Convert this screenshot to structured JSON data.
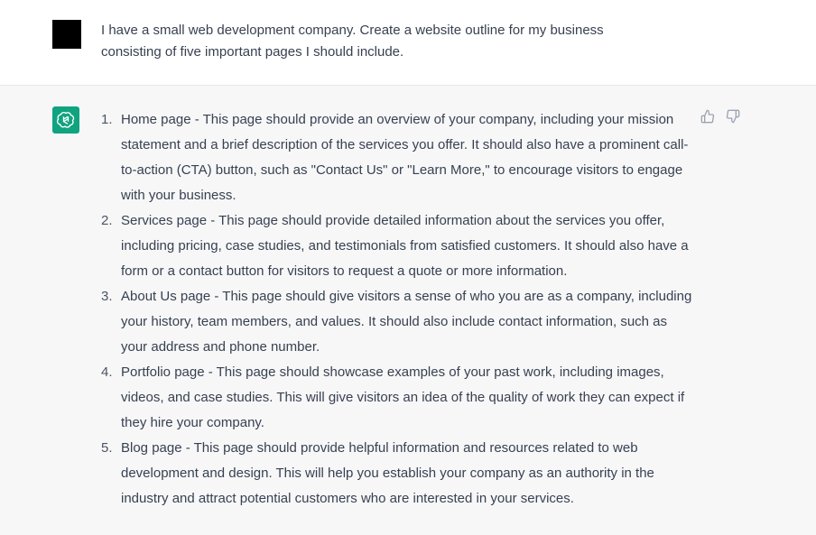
{
  "user_message": {
    "text": "I have a small web development company. Create a website outline for my business consisting of five important pages I should include."
  },
  "assistant_message": {
    "items": [
      {
        "number": "1.",
        "text": "Home page - This page should provide an overview of your company, including your mission statement and a brief description of the services you offer. It should also have a prominent call-to-action (CTA) button, such as \"Contact Us\" or \"Learn More,\" to encourage visitors to engage with your business."
      },
      {
        "number": "2.",
        "text": "Services page - This page should provide detailed information about the services you offer, including pricing, case studies, and testimonials from satisfied customers. It should also have a form or a contact button for visitors to request a quote or more information."
      },
      {
        "number": "3.",
        "text": "About Us page - This page should give visitors a sense of who you are as a company, including your history, team members, and values. It should also include contact information, such as your address and phone number."
      },
      {
        "number": "4.",
        "text": "Portfolio page - This page should showcase examples of your past work, including images, videos, and case studies. This will give visitors an idea of the quality of work they can expect if they hire your company."
      },
      {
        "number": "5.",
        "text": "Blog page - This page should provide helpful information and resources related to web development and design. This will help you establish your company as an authority in the industry and attract potential customers who are interested in your services."
      }
    ]
  },
  "icons": {
    "user_avatar": "user-avatar",
    "assistant_avatar": "openai-logo-icon",
    "thumbs_up": "thumbs-up-icon",
    "thumbs_down": "thumbs-down-icon"
  },
  "colors": {
    "assistant_bg": "#f7f7f8",
    "user_bg": "#ffffff",
    "brand_green": "#10a37f",
    "text": "#374151"
  }
}
